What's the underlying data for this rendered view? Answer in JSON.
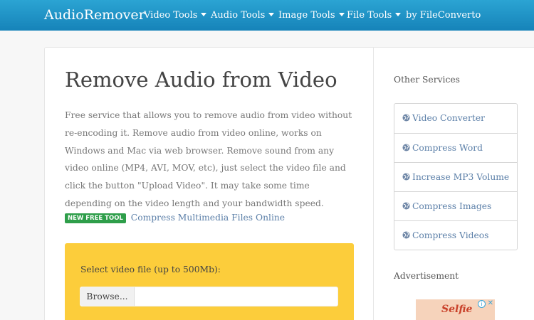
{
  "navbar": {
    "brand": "AudioRemover",
    "items": [
      {
        "label": "Video Tools"
      },
      {
        "label": "Audio Tools"
      },
      {
        "label": "Image Tools"
      },
      {
        "label": "File Tools"
      },
      {
        "label": "by FileConverto"
      }
    ]
  },
  "main": {
    "title": "Remove Audio from Video",
    "description": "Free service that allows you to remove audio from video without re-encoding it. Remove audio from video online, works on Windows and Mac via web browser. Remove sound from any video online (MP4, AVI, MOV, etc), just select the video file and click the button \"Upload Video\". It may take some time depending on the video length and your bandwidth speed.",
    "promo": {
      "badge": "NEW FREE TOOL",
      "link": "Compress Multimedia Files Online"
    },
    "upload": {
      "label": "Select video file (up to 500Mb):",
      "browse": "Browse..."
    }
  },
  "sidebar": {
    "heading": "Other Services",
    "services": [
      {
        "label": "Video Converter"
      },
      {
        "label": "Compress Word"
      },
      {
        "label": "Increase MP3 Volume"
      },
      {
        "label": "Compress Images"
      },
      {
        "label": "Compress Videos"
      }
    ],
    "ad_heading": "Advertisement",
    "ad_text": "Selfie"
  },
  "colors": {
    "navbar": "#1a8cc2",
    "upload_panel": "#fccd3b",
    "badge": "#2e9e4a",
    "link": "#5b7fa8"
  },
  "icons": {
    "service": "globe-icon",
    "nav_dropdown": "caret-down-icon",
    "ad_info": "info-icon",
    "ad_close": "close-icon"
  }
}
